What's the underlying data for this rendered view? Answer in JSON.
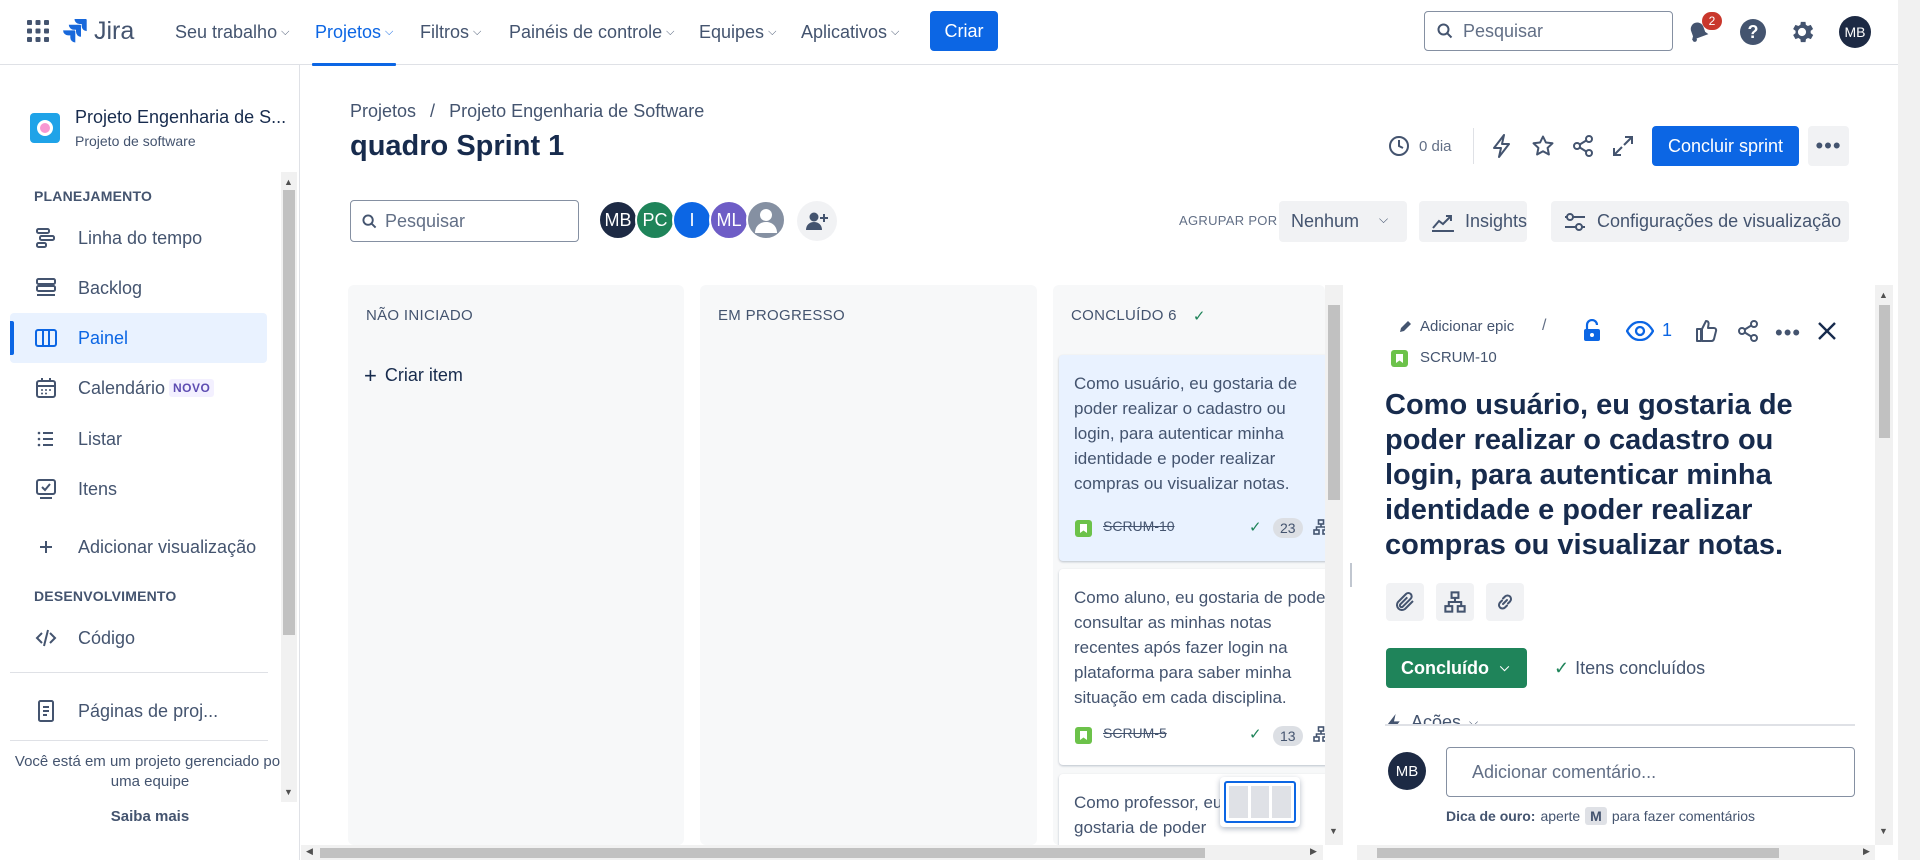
{
  "topnav": {
    "logo": "Jira",
    "items": [
      "Seu trabalho",
      "Projetos",
      "Filtros",
      "Painéis de controle",
      "Equipes",
      "Aplicativos"
    ],
    "create_label": "Criar",
    "search_placeholder": "Pesquisar",
    "notifications_count": "2",
    "user_initials": "MB"
  },
  "sidebar": {
    "project_name": "Projeto Engenharia de S...",
    "project_type": "Projeto de software",
    "planning_heading": "PLANEJAMENTO",
    "planning_items": [
      "Linha do tempo",
      "Backlog",
      "Painel",
      "Calendário",
      "Listar",
      "Itens"
    ],
    "new_badge": "NOVO",
    "add_view": "Adicionar visualização",
    "dev_heading": "DESENVOLVIMENTO",
    "code": "Código",
    "project_pages": "Páginas de proj...",
    "footer_text": "Você está em um projeto gerenciado por uma equipe",
    "learn_more": "Saiba mais"
  },
  "header": {
    "breadcrumb_root": "Projetos",
    "breadcrumb_sep": "/",
    "breadcrumb_project": "Projeto Engenharia de Software",
    "title": "quadro Sprint 1",
    "days": "0 dia",
    "complete_sprint": "Concluir sprint"
  },
  "toolbar": {
    "search_placeholder": "Pesquisar",
    "avatars": [
      "MB",
      "PC",
      "I",
      "ML"
    ],
    "group_by_label": "AGRUPAR POR",
    "group_by_value": "Nenhum",
    "insights": "Insights",
    "view_settings": "Configurações de visualização"
  },
  "columns": [
    {
      "title": "NÃO INICIADO",
      "create": "Criar item"
    },
    {
      "title": "EM PROGRESSO"
    },
    {
      "title": "CONCLUÍDO 6"
    }
  ],
  "cards": [
    {
      "text": "Como usuário, eu gostaria de poder realizar o cadastro ou login, para autenticar minha identidade e poder realizar compras ou visualizar notas.",
      "key": "SCRUM-10",
      "points": "23"
    },
    {
      "text": "Como aluno, eu gostaria de poder consultar as minhas notas recentes após fazer login na plataforma para saber minha situação em cada disciplina.",
      "key": "SCRUM-5",
      "points": "13"
    },
    {
      "text": "Como professor, eu gostaria de poder visualizar m",
      "key": "",
      "points": ""
    }
  ],
  "detail": {
    "add_epic": "Adicionar epic",
    "sep": "/",
    "watchers": "1",
    "issue_key": "SCRUM-10",
    "title": "Como usuário, eu gostaria de poder realizar o cadastro ou login, para autenticar minha identidade e poder realizar compras ou visualizar notas.",
    "status": "Concluído",
    "resolution": "Itens concluídos",
    "actions": "Ações",
    "commenter": "MB",
    "comment_placeholder": "Adicionar comentário...",
    "tip_bold": "Dica de ouro:",
    "tip_pre": "aperte",
    "tip_key": "M",
    "tip_post": "para fazer comentários"
  },
  "colors": {
    "brand": "#0c66e4",
    "done_green": "#1f845a",
    "story_green": "#6cc24a",
    "text": "#172b4d",
    "subtle": "#44546f"
  }
}
